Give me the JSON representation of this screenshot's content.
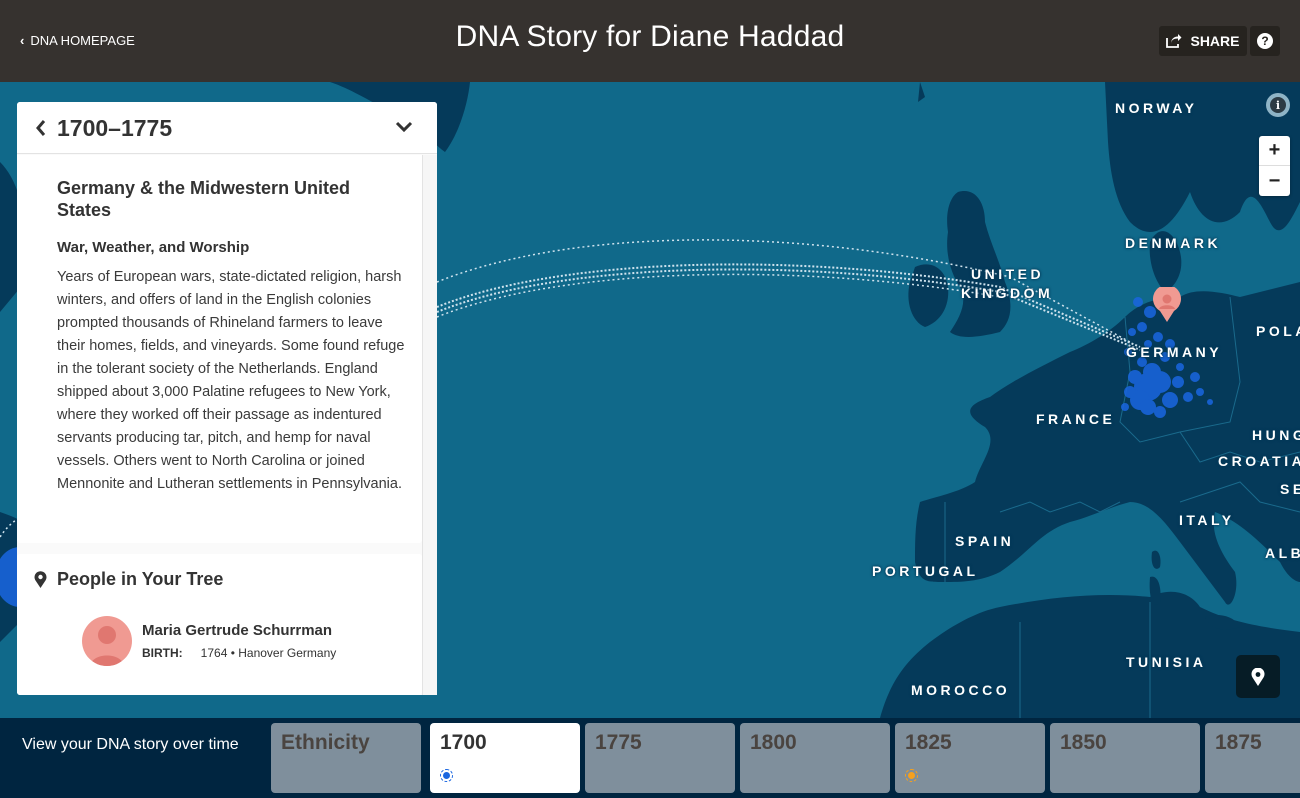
{
  "header": {
    "back_label": "DNA HOMEPAGE",
    "title": "DNA Story for Diane Haddad",
    "share_label": "SHARE",
    "help_icon": "question-circle-icon",
    "share_icon": "share-external-icon"
  },
  "map": {
    "info_icon": "info-icon",
    "zoom_in_label": "+",
    "zoom_out_label": "−",
    "locate_icon": "map-pin-icon",
    "colors": {
      "water": "#10698a",
      "land": "#053a5a",
      "border": "#1a6a8c",
      "community_dots": "#1a66e0",
      "ancestor_pin": "#f09a92",
      "migration_path": "#cfe3ee"
    },
    "labels": {
      "norway": "NORWAY",
      "denmark": "DENMARK",
      "united": "UNITED",
      "kingdom": "KINGDOM",
      "germany": "GERMANY",
      "poland": "POLA",
      "france": "FRANCE",
      "hungary": "HUNG",
      "croatia": "CROATIA",
      "serbia": "SE",
      "italy": "ITALY",
      "albania": "ALB",
      "spain": "SPAIN",
      "portugal": "PORTUGAL",
      "tunisia": "TUNISIA",
      "morocco": "MOROCCO"
    }
  },
  "panel": {
    "period": "1700–1775",
    "region_heading": "Germany & the Midwestern United States",
    "story_subheading": "War, Weather, and Worship",
    "story_body": "Years of European wars, state-dictated religion, harsh winters, and offers of land in the English colonies prompted thousands of Rhineland farmers to leave their homes, fields, and vineyards. Some found refuge in the tolerant society of the Netherlands. England shipped about 3,000 Palatine refugees to New York, where they worked off their passage as indentured servants producing tar, pitch, and hemp for naval vessels. Others went to North Carolina or joined Mennonite and Lutheran settlements in Pennsylvania.",
    "people_title": "People in Your Tree",
    "people": [
      {
        "name": "Maria Gertrude Schurrman",
        "birth_label": "BIRTH:",
        "birth_value": "1764 • Hanover Germany"
      }
    ]
  },
  "timeline": {
    "label": "View your DNA story over time",
    "items": [
      {
        "label": "Ethnicity",
        "active": false,
        "dot": null
      },
      {
        "label": "1700",
        "active": true,
        "dot": "#1a66e0"
      },
      {
        "label": "1775",
        "active": false,
        "dot": null
      },
      {
        "label": "1800",
        "active": false,
        "dot": null
      },
      {
        "label": "1825",
        "active": false,
        "dot": "#f5a01e"
      },
      {
        "label": "1850",
        "active": false,
        "dot": null
      },
      {
        "label": "1875",
        "active": false,
        "dot": null
      }
    ]
  }
}
